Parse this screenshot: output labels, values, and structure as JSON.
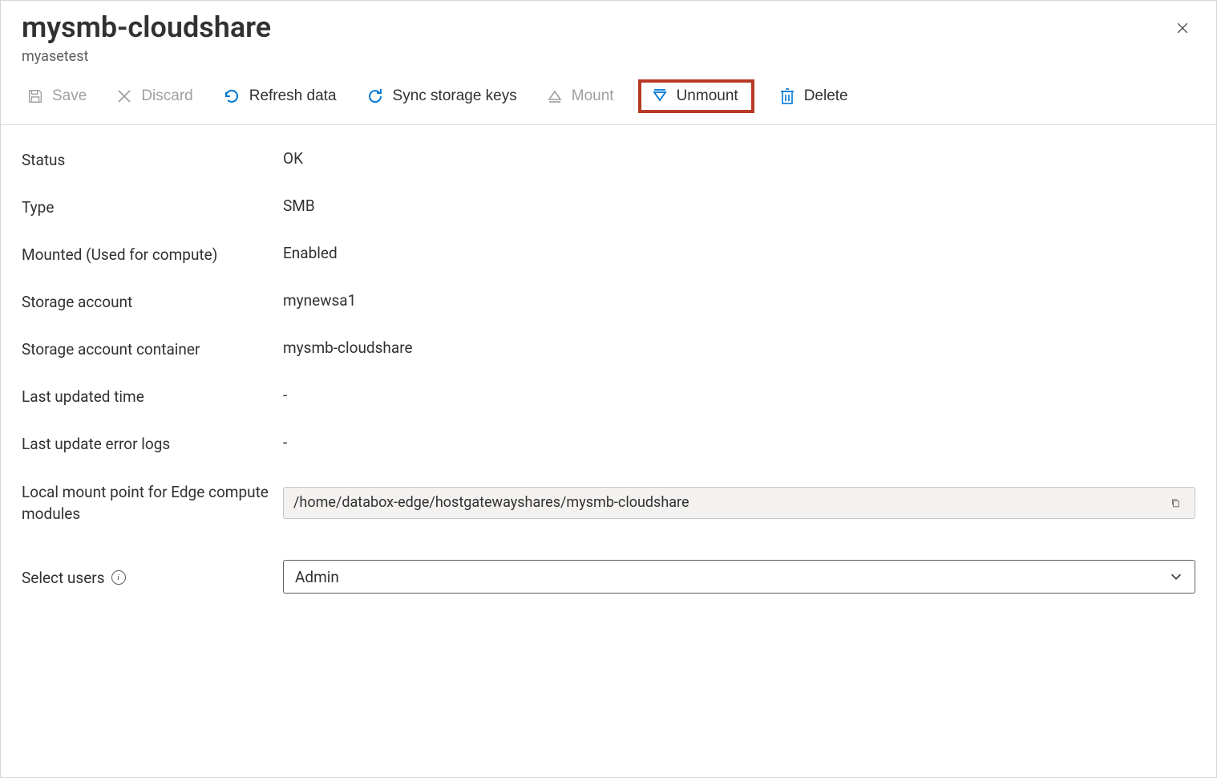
{
  "header": {
    "title": "mysmb-cloudshare",
    "subtitle": "myasetest"
  },
  "toolbar": {
    "save": "Save",
    "discard": "Discard",
    "refresh": "Refresh data",
    "sync": "Sync storage keys",
    "mount": "Mount",
    "unmount": "Unmount",
    "delete": "Delete"
  },
  "fields": {
    "status_label": "Status",
    "status_value": "OK",
    "type_label": "Type",
    "type_value": "SMB",
    "mounted_label": "Mounted (Used for compute)",
    "mounted_value": "Enabled",
    "storage_account_label": "Storage account",
    "storage_account_value": "mynewsa1",
    "container_label": "Storage account container",
    "container_value": "mysmb-cloudshare",
    "last_updated_label": "Last updated time",
    "last_updated_value": "-",
    "error_logs_label": "Last update error logs",
    "error_logs_value": "-",
    "mount_point_label": "Local mount point for Edge compute modules",
    "mount_point_value": "/home/databox-edge/hostgatewayshares/mysmb-cloudshare",
    "select_users_label": "Select users",
    "select_users_value": "Admin"
  }
}
